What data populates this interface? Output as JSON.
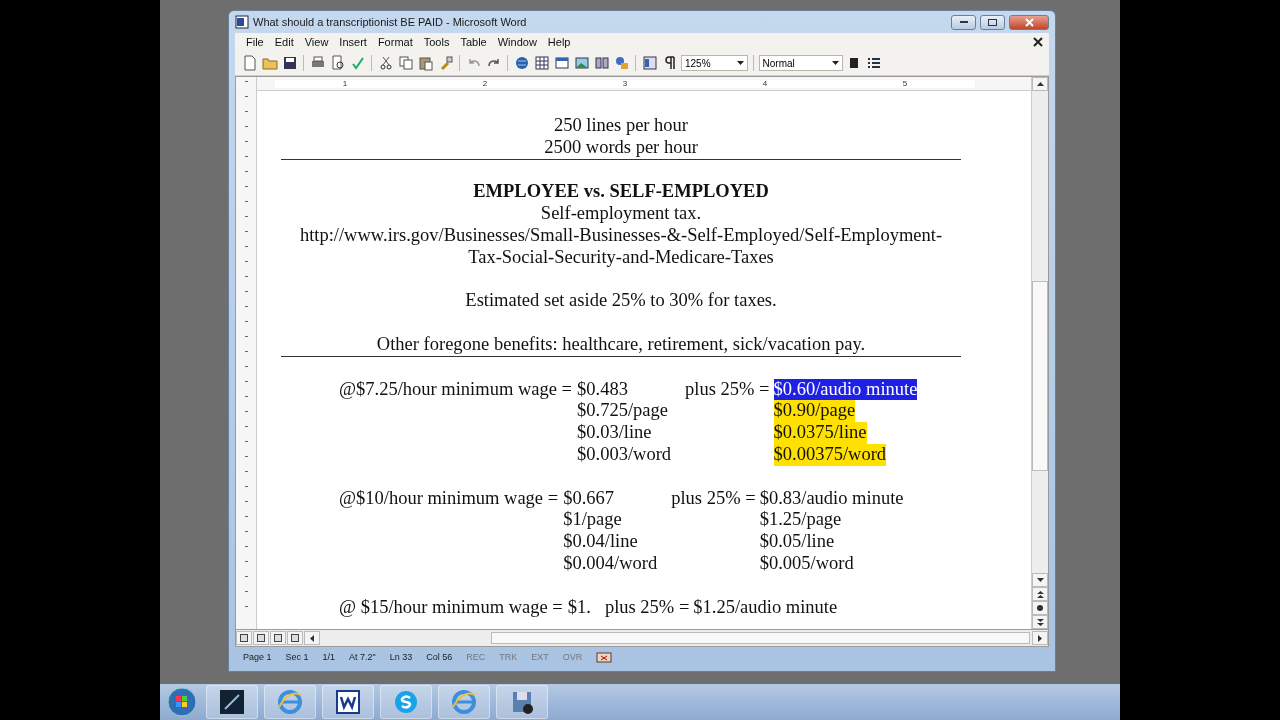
{
  "window": {
    "title": "What should a transcriptionist BE PAID - Microsoft Word"
  },
  "menu": [
    "File",
    "Edit",
    "View",
    "Insert",
    "Format",
    "Tools",
    "Table",
    "Window",
    "Help"
  ],
  "toolbar": {
    "zoom": "125%",
    "style": "Normal"
  },
  "ruler": [
    "1",
    "2",
    "3",
    "4",
    "5"
  ],
  "document": [
    {
      "kind": "center",
      "text": "250 lines per hour"
    },
    {
      "kind": "center",
      "text": "2500 words per hour"
    },
    {
      "kind": "rule"
    },
    {
      "kind": "blank"
    },
    {
      "kind": "heading",
      "text": "EMPLOYEE vs. SELF-EMPLOYED"
    },
    {
      "kind": "center",
      "text": "Self-employment tax."
    },
    {
      "kind": "center",
      "text": "http://www.irs.gov/Businesses/Small-Businesses-&-Self-Employed/Self-Employment-"
    },
    {
      "kind": "center",
      "text": "Tax-Social-Security-and-Medicare-Taxes"
    },
    {
      "kind": "blank"
    },
    {
      "kind": "center",
      "text": "Estimated set aside 25% to 30% for taxes."
    },
    {
      "kind": "blank"
    },
    {
      "kind": "center",
      "text": "Other foregone benefits: healthcare, retirement, sick/vacation pay."
    },
    {
      "kind": "rule"
    },
    {
      "kind": "blank"
    },
    {
      "kind": "rates",
      "rows": [
        {
          "label": "@$7.25/hour minimum wage = ",
          "base": "$0.483",
          "plus": "plus 25% =",
          "value": "$0.60/audio minute",
          "selected": true,
          "highlighted": true
        },
        {
          "base": "$0.725/page",
          "value": "$0.90/page",
          "selected": false,
          "highlighted": true
        },
        {
          "base": "$0.03/line",
          "value": "$0.0375/line",
          "selected": false,
          "highlighted": true
        },
        {
          "base": "$0.003/word",
          "value": "$0.00375/word",
          "selected": false,
          "highlighted": true
        }
      ]
    },
    {
      "kind": "blank"
    },
    {
      "kind": "rates",
      "rows": [
        {
          "label": "@$10/hour minimum wage = ",
          "base": "$0.667",
          "plus": "plus 25% =",
          "value": "$0.83/audio minute",
          "selected": false,
          "highlighted": false
        },
        {
          "base": "$1/page",
          "value": "$1.25/page",
          "selected": false,
          "highlighted": false
        },
        {
          "base": "$0.04/line",
          "value": "$0.05/line",
          "selected": false,
          "highlighted": false
        },
        {
          "base": "$0.004/word",
          "value": "$0.005/word",
          "selected": false,
          "highlighted": false
        }
      ]
    },
    {
      "kind": "blank"
    },
    {
      "kind": "rates",
      "rows": [
        {
          "label": "@ $15/hour minimum wage = ",
          "base": "$1.",
          "plus": "plus 25% =",
          "value": "$1.25/audio minute",
          "selected": false,
          "highlighted": false
        }
      ]
    }
  ],
  "status_bar": [
    {
      "text": "Page 1",
      "disabled": false
    },
    {
      "text": "Sec 1",
      "disabled": false
    },
    {
      "text": "1/1",
      "disabled": false
    },
    {
      "text": "At 7.2\"",
      "disabled": false
    },
    {
      "text": "Ln 33",
      "disabled": false
    },
    {
      "text": "Col 56",
      "disabled": false
    },
    {
      "text": "REC",
      "disabled": true
    },
    {
      "text": "TRK",
      "disabled": true
    },
    {
      "text": "EXT",
      "disabled": true
    },
    {
      "text": "OVR",
      "disabled": true
    }
  ]
}
